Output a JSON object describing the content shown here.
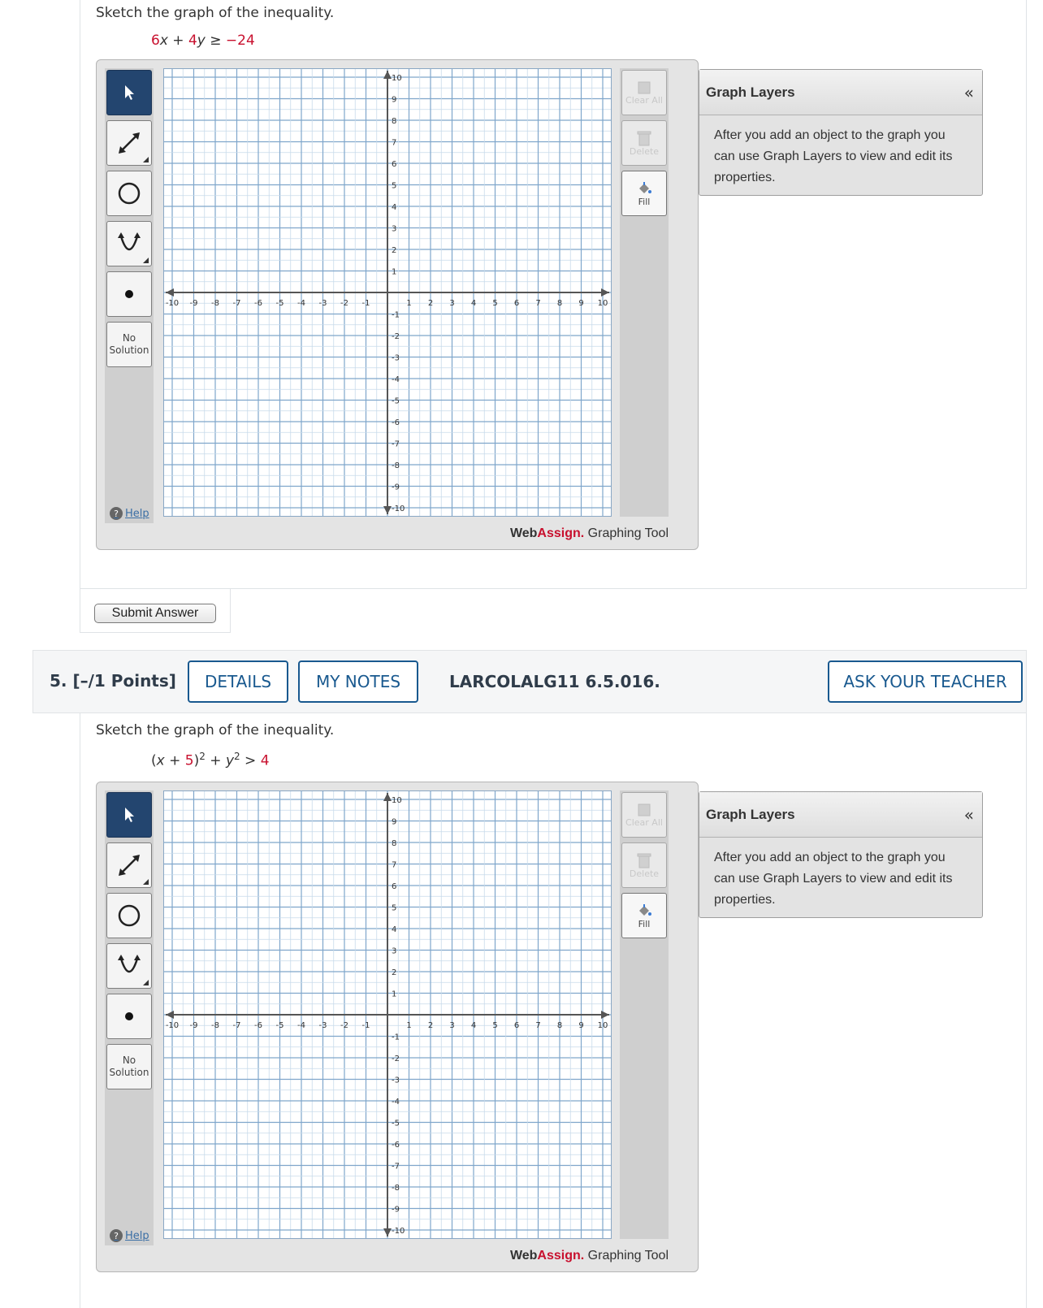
{
  "questions": [
    {
      "prompt": "Sketch the graph of the inequality.",
      "inequality": {
        "t1": "6",
        "t2": "x",
        "t3": " + ",
        "t4": "4",
        "t5": "y",
        "t6": " ≥ ",
        "t7": "−24"
      }
    },
    {
      "prompt": "Sketch the graph of the inequality.",
      "inequality": {
        "t1": "(",
        "t2": "x",
        "t3": " + ",
        "t4": "5",
        "t5": ")",
        "t6": "2",
        "t7": " + ",
        "t8": "y",
        "t9": "2",
        "t10": " > ",
        "t11": "4"
      }
    }
  ],
  "tool": {
    "no_solution_line1": "No",
    "no_solution_line2": "Solution",
    "help": "Help",
    "clear_all": "Clear All",
    "delete": "Delete",
    "fill": "Fill",
    "brand_web": "Web",
    "brand_assign": "Assign.",
    "brand_tool": " Graphing Tool",
    "layers_title": "Graph Layers",
    "layers_collapse": "«",
    "layers_text": "After you add an object to the graph you can use Graph Layers to view and edit its properties.",
    "axis": {
      "min": -10,
      "max": 10
    }
  },
  "submit_label": "Submit Answer",
  "question_header": {
    "number": "5.",
    "points": "[–/1 Points]",
    "details": "DETAILS",
    "my_notes": "MY NOTES",
    "code": "LARCOLALG11 6.5.016.",
    "ask_teacher": "ASK YOUR TEACHER"
  },
  "colors": {
    "accent": "#19598f",
    "red": "#c8102e",
    "active_tool": "#23456f"
  }
}
